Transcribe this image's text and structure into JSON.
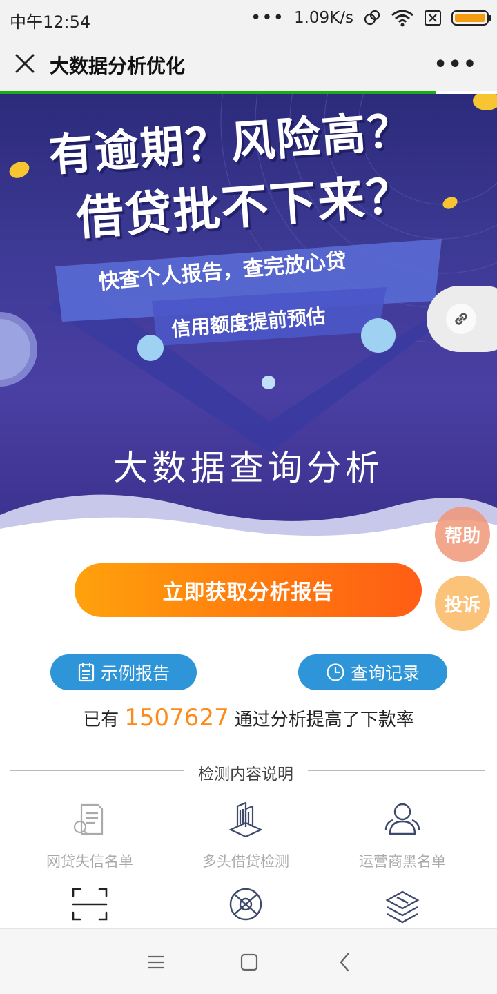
{
  "status_bar": {
    "time": "中午12:54",
    "dots": "•••",
    "speed": "1.09K/s",
    "battery_level": 0.9,
    "battery_color": "#f39c12"
  },
  "title_bar": {
    "title": "大数据分析优化",
    "more_label": "•••"
  },
  "banner": {
    "headline_line1": "有逾期？风险高？",
    "headline_line2": "借贷批不下来？",
    "ribbon_line1": "快查个人报告，查完放心贷",
    "ribbon_line2": "信用额度提前预估",
    "subtitle": "大数据查询分析"
  },
  "floating": {
    "link_icon": "link-icon",
    "help_label": "帮助",
    "complain_label": "投诉"
  },
  "cta": {
    "label": "立即获取分析报告"
  },
  "actions": {
    "sample_report": "示例报告",
    "query_history": "查询记录"
  },
  "stats": {
    "prefix": "已有",
    "count": "1507627",
    "suffix": "通过分析提高了下款率"
  },
  "section": {
    "title": "检测内容说明"
  },
  "features": [
    {
      "icon": "document-icon",
      "label": "网贷失信名单"
    },
    {
      "icon": "building-icon",
      "label": "多头借贷检测"
    },
    {
      "icon": "users-icon",
      "label": "运营商黑名单"
    },
    {
      "icon": "scan-icon",
      "label": ""
    },
    {
      "icon": "globe-icon",
      "label": ""
    },
    {
      "icon": "layers-icon",
      "label": ""
    }
  ],
  "colors": {
    "accent_orange": "#ff7a0e",
    "pill_blue": "#2e95d8",
    "banner_purple": "#3d3a95",
    "progress_green": "#1aad19"
  }
}
